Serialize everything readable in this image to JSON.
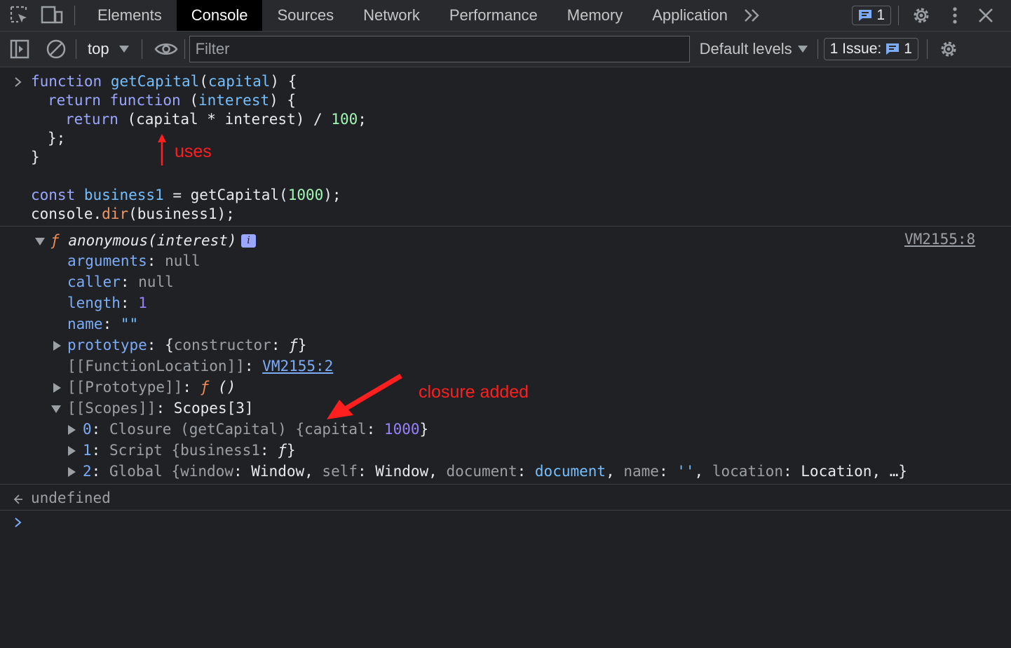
{
  "tabs": {
    "items": [
      {
        "label": "Elements"
      },
      {
        "label": "Console",
        "active": true
      },
      {
        "label": "Sources"
      },
      {
        "label": "Network"
      },
      {
        "label": "Performance"
      },
      {
        "label": "Memory"
      },
      {
        "label": "Application"
      }
    ],
    "messages_count": "1"
  },
  "toolbar": {
    "context": "top",
    "filter_placeholder": "Filter",
    "levels": "Default levels",
    "issues_label": "1 Issue:",
    "issues_count": "1"
  },
  "input_code": {
    "l1": {
      "kw": "function",
      "name": "getCapital",
      "p1": "(",
      "param": "capital",
      "p2": ") {"
    },
    "l2": {
      "kw1": "return",
      "kw2": "function",
      "p1": " (",
      "param": "interest",
      "p2": ") {"
    },
    "l3": {
      "kw": "return",
      "expr": " (capital * interest) / ",
      "num": "100",
      "end": ";"
    },
    "l4": "};",
    "l5": "}",
    "l6": {
      "kw": "const",
      "var": "business1",
      "mid": " = getCapital(",
      "num": "1000",
      "end": ");"
    },
    "l7": {
      "obj": "console.",
      "method": "dir",
      "args": "(business1);"
    }
  },
  "annotations": {
    "uses": "uses",
    "closure": "closure added"
  },
  "output": {
    "source_link": "VM2155:8",
    "header": {
      "f": "ƒ",
      "sig": "anonymous(interest)",
      "info": "i"
    },
    "arguments": {
      "key": "arguments",
      "value": "null"
    },
    "caller": {
      "key": "caller",
      "value": "null"
    },
    "length": {
      "key": "length",
      "value": "1"
    },
    "name": {
      "key": "name",
      "value": "\"\""
    },
    "prototype": {
      "key": "prototype",
      "open": "{",
      "inner_key": "constructor",
      "inner_val": "ƒ",
      "close": "}"
    },
    "function_location": {
      "key": "[[FunctionLocation]]",
      "value": "VM2155:2"
    },
    "proto": {
      "key": "[[Prototype]]",
      "f": "ƒ",
      "value": "()"
    },
    "scopes": {
      "key": "[[Scopes]]",
      "value": "Scopes[3]"
    },
    "scope0": {
      "idx": "0",
      "label": "Closure (getCapital) {",
      "k": "capital",
      "v": "1000",
      "end": "}"
    },
    "scope1": {
      "idx": "1",
      "label": "Script {",
      "k": "business1",
      "v": "ƒ",
      "end": "}"
    },
    "scope2": {
      "idx": "2",
      "label": "Global {",
      "k1": "window",
      "v1": "Window",
      "k2": "self",
      "v2": "Window",
      "k3": "document",
      "v3": "document",
      "k4": "name",
      "v4": "''",
      "k5": "location",
      "v5": "Location",
      "end": "…}"
    }
  },
  "result": "undefined"
}
